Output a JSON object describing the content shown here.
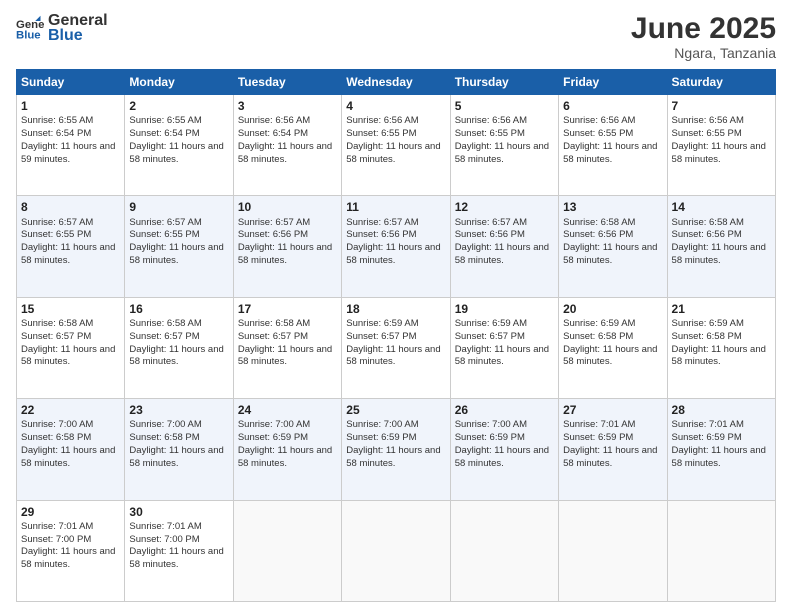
{
  "header": {
    "logo_general": "General",
    "logo_blue": "Blue",
    "month_year": "June 2025",
    "location": "Ngara, Tanzania"
  },
  "days_of_week": [
    "Sunday",
    "Monday",
    "Tuesday",
    "Wednesday",
    "Thursday",
    "Friday",
    "Saturday"
  ],
  "weeks": [
    [
      {
        "day": 1,
        "sunrise": "6:55 AM",
        "sunset": "6:54 PM",
        "daylight": "11 hours and 59 minutes."
      },
      {
        "day": 2,
        "sunrise": "6:55 AM",
        "sunset": "6:54 PM",
        "daylight": "11 hours and 58 minutes."
      },
      {
        "day": 3,
        "sunrise": "6:56 AM",
        "sunset": "6:54 PM",
        "daylight": "11 hours and 58 minutes."
      },
      {
        "day": 4,
        "sunrise": "6:56 AM",
        "sunset": "6:55 PM",
        "daylight": "11 hours and 58 minutes."
      },
      {
        "day": 5,
        "sunrise": "6:56 AM",
        "sunset": "6:55 PM",
        "daylight": "11 hours and 58 minutes."
      },
      {
        "day": 6,
        "sunrise": "6:56 AM",
        "sunset": "6:55 PM",
        "daylight": "11 hours and 58 minutes."
      },
      {
        "day": 7,
        "sunrise": "6:56 AM",
        "sunset": "6:55 PM",
        "daylight": "11 hours and 58 minutes."
      }
    ],
    [
      {
        "day": 8,
        "sunrise": "6:57 AM",
        "sunset": "6:55 PM",
        "daylight": "11 hours and 58 minutes."
      },
      {
        "day": 9,
        "sunrise": "6:57 AM",
        "sunset": "6:55 PM",
        "daylight": "11 hours and 58 minutes."
      },
      {
        "day": 10,
        "sunrise": "6:57 AM",
        "sunset": "6:56 PM",
        "daylight": "11 hours and 58 minutes."
      },
      {
        "day": 11,
        "sunrise": "6:57 AM",
        "sunset": "6:56 PM",
        "daylight": "11 hours and 58 minutes."
      },
      {
        "day": 12,
        "sunrise": "6:57 AM",
        "sunset": "6:56 PM",
        "daylight": "11 hours and 58 minutes."
      },
      {
        "day": 13,
        "sunrise": "6:58 AM",
        "sunset": "6:56 PM",
        "daylight": "11 hours and 58 minutes."
      },
      {
        "day": 14,
        "sunrise": "6:58 AM",
        "sunset": "6:56 PM",
        "daylight": "11 hours and 58 minutes."
      }
    ],
    [
      {
        "day": 15,
        "sunrise": "6:58 AM",
        "sunset": "6:57 PM",
        "daylight": "11 hours and 58 minutes."
      },
      {
        "day": 16,
        "sunrise": "6:58 AM",
        "sunset": "6:57 PM",
        "daylight": "11 hours and 58 minutes."
      },
      {
        "day": 17,
        "sunrise": "6:58 AM",
        "sunset": "6:57 PM",
        "daylight": "11 hours and 58 minutes."
      },
      {
        "day": 18,
        "sunrise": "6:59 AM",
        "sunset": "6:57 PM",
        "daylight": "11 hours and 58 minutes."
      },
      {
        "day": 19,
        "sunrise": "6:59 AM",
        "sunset": "6:57 PM",
        "daylight": "11 hours and 58 minutes."
      },
      {
        "day": 20,
        "sunrise": "6:59 AM",
        "sunset": "6:58 PM",
        "daylight": "11 hours and 58 minutes."
      },
      {
        "day": 21,
        "sunrise": "6:59 AM",
        "sunset": "6:58 PM",
        "daylight": "11 hours and 58 minutes."
      }
    ],
    [
      {
        "day": 22,
        "sunrise": "7:00 AM",
        "sunset": "6:58 PM",
        "daylight": "11 hours and 58 minutes."
      },
      {
        "day": 23,
        "sunrise": "7:00 AM",
        "sunset": "6:58 PM",
        "daylight": "11 hours and 58 minutes."
      },
      {
        "day": 24,
        "sunrise": "7:00 AM",
        "sunset": "6:59 PM",
        "daylight": "11 hours and 58 minutes."
      },
      {
        "day": 25,
        "sunrise": "7:00 AM",
        "sunset": "6:59 PM",
        "daylight": "11 hours and 58 minutes."
      },
      {
        "day": 26,
        "sunrise": "7:00 AM",
        "sunset": "6:59 PM",
        "daylight": "11 hours and 58 minutes."
      },
      {
        "day": 27,
        "sunrise": "7:01 AM",
        "sunset": "6:59 PM",
        "daylight": "11 hours and 58 minutes."
      },
      {
        "day": 28,
        "sunrise": "7:01 AM",
        "sunset": "6:59 PM",
        "daylight": "11 hours and 58 minutes."
      }
    ],
    [
      {
        "day": 29,
        "sunrise": "7:01 AM",
        "sunset": "7:00 PM",
        "daylight": "11 hours and 58 minutes."
      },
      {
        "day": 30,
        "sunrise": "7:01 AM",
        "sunset": "7:00 PM",
        "daylight": "11 hours and 58 minutes."
      },
      null,
      null,
      null,
      null,
      null
    ]
  ]
}
